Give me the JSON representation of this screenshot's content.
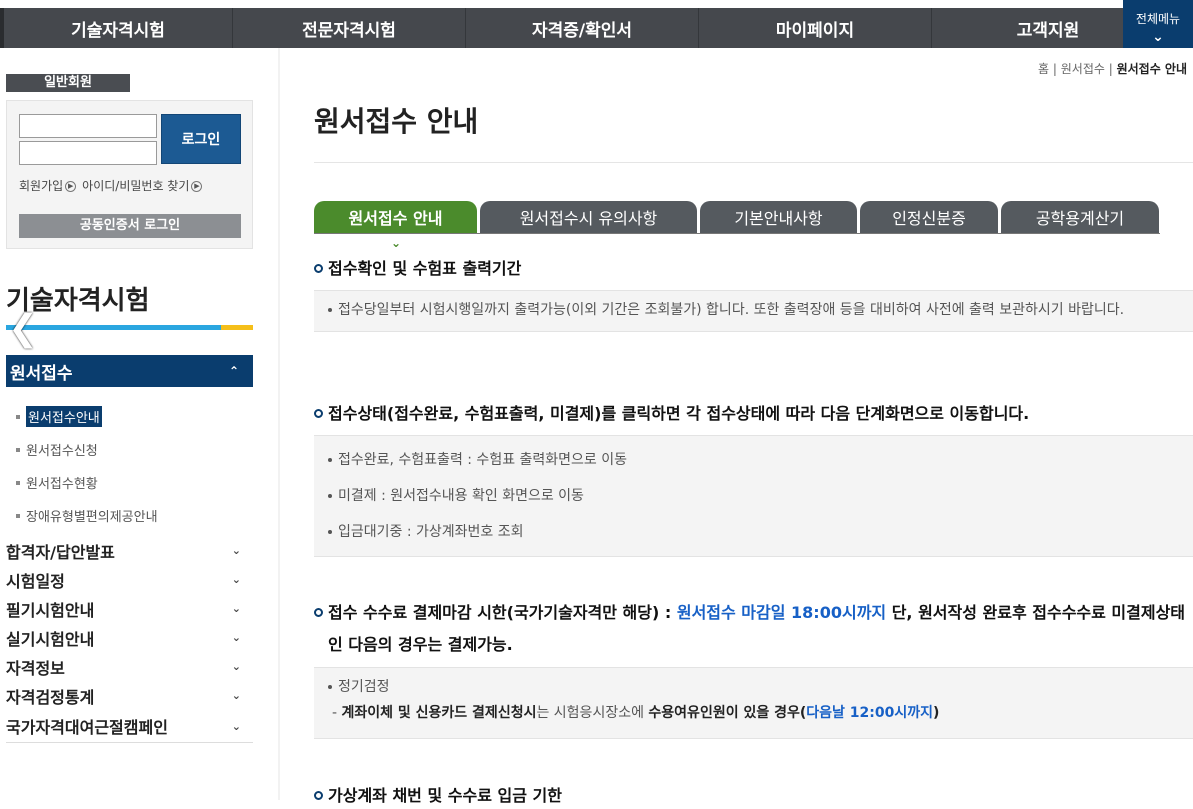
{
  "topnav": {
    "items": [
      "기술자격시험",
      "전문자격시험",
      "자격증/확인서",
      "마이페이지",
      "고객지원"
    ],
    "all_menu": "전체메뉴"
  },
  "sidebar": {
    "member_tab": "일반회원",
    "login_button": "로그인",
    "signup_link": "회원가입",
    "find_link": "아이디/비밀번호 찾기",
    "cert_login": "공동인증서 로그인",
    "section_title": "기술자격시험",
    "active_menu": "원서접수",
    "submenu": [
      "원서접수안내",
      "원서접수신청",
      "원서접수현황",
      "장애유형별편의제공안내"
    ],
    "menu": [
      "합격자/답안발표",
      "시험일정",
      "필기시험안내",
      "실기시험안내",
      "자격정보",
      "자격검정통계",
      "국가자격대여근절캠페인"
    ]
  },
  "breadcrumb": {
    "home": "홈",
    "mid": "원서접수",
    "current": "원서접수 안내"
  },
  "page_title": "원서접수 안내",
  "tabs": [
    "원서접수 안내",
    "원서접수시 유의사항",
    "기본안내사항",
    "인정신분증",
    "공학용계산기"
  ],
  "sections": {
    "s1": {
      "head": "접수확인 및 수험표 출력기간",
      "items": [
        "접수당일부터 시험시행일까지 출력가능(이외 기간은 조회불가) 합니다. 또한 출력장애 등을 대비하여 사전에 출력 보관하시기 바랍니다."
      ]
    },
    "s2": {
      "head": "접수상태(접수완료, 수험표출력, 미결제)를 클릭하면 각 접수상태에 따라 다음 단계화면으로 이동합니다.",
      "items": [
        "접수완료, 수험표출력 : 수험표 출력화면으로 이동",
        "미결제 : 원서접수내용 확인 화면으로 이동",
        "입금대기중 : 가상계좌번호 조회"
      ]
    },
    "s3": {
      "head_a": "접수 수수료 결제마감 시한(국가기술자격만 해당) : ",
      "head_b": "원서접수 마감일 18:00시까지",
      "head_c": " 단, 원서작성 완료후 접수수수료 미결제상태인 다음의 경우는 결제가능.",
      "item": "정기검정",
      "sub_a": "- ",
      "sub_b": "계좌이체 및 신용카드 결제신청시",
      "sub_c": "는 시험응시장소에 ",
      "sub_d": "수용여유인원이 있을 경우(",
      "sub_e": "다음날 12:00시까지",
      "sub_f": ")"
    },
    "s4": {
      "head": "가상계좌 채번 및 수수료 입금 기한"
    }
  }
}
